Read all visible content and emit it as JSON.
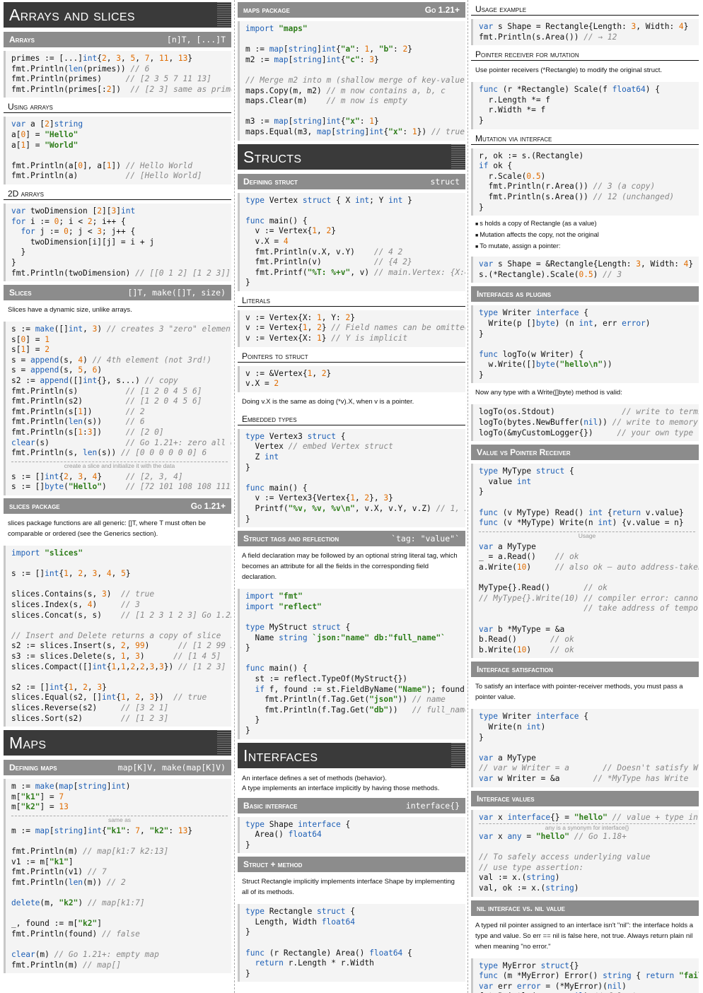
{
  "col1": {
    "arrays_title": "Arrays and slices",
    "arrays_h": "Arrays",
    "arrays_sig": "[n]T, [...]T",
    "using_arrays_h": "Using arrays",
    "twod_h": "2D arrays",
    "slices_h": "Slices",
    "slices_sig": "[]T, make([]T, size)",
    "slices_prose": "Slices have a dynamic size, unlike arrays.",
    "slices_divider": "create a slice and initialize it with the data",
    "slices_pkg_h": "slices package",
    "slices_pkg_ver": "Go 1.21+",
    "slices_pkg_prose": "slices package functions are all generic: []T, where T must often be comparable or ordered (see the Generics section).",
    "maps_title": "Maps",
    "defmaps_h": "Defining maps",
    "defmaps_sig": "map[K]V, make(map[K]V)",
    "maps_divider": "same as"
  },
  "col2": {
    "maps_pkg_h": "maps package",
    "maps_pkg_ver": "Go 1.21+",
    "structs_title": "Structs",
    "defstruct_h": "Defining struct",
    "defstruct_sig": "struct",
    "literals_h": "Literals",
    "pointers_h": "Pointers to struct",
    "pointers_prose": "Doing v.X is the same as doing (*v).X, when v is a pointer.",
    "embedded_h": "Embedded types",
    "tags_h": "Struct tags and reflection",
    "tags_sig": "`tag: \"value\"`",
    "tags_prose": "A field declaration may be followed by an optional string literal tag, which becomes an attribute for all the fields in the corresponding field declaration.",
    "interfaces_title": "Interfaces",
    "interfaces_prose1": "An interface defines a set of methods (behavior).",
    "interfaces_prose2": "A type implements an interface implicitly by having those methods.",
    "basic_h": "Basic interface",
    "basic_sig": "interface{}",
    "structmethod_h": "Struct + method",
    "structmethod_prose": "Struct Rectangle implicitly implements interface Shape by implementing all of its methods."
  },
  "col3": {
    "usage_h": "Usage example",
    "ptrrecv_h": "Pointer receiver for mutation",
    "ptrrecv_prose": "Use pointer receivers (*Rectangle) to modify the original struct.",
    "mutiface_h": "Mutation via interface",
    "bullets": [
      "s holds a copy of Rectangle (as a value)",
      "Mutation affects the copy, not the original",
      "To mutate, assign a pointer:"
    ],
    "plugins_h": "Interfaces as plugins",
    "plugins_prose": "Now any type with a Write([]byte) method is valid:",
    "vp_h": "Value vs Pointer Receiver",
    "vp_divider": "Usage",
    "satisfaction_h": "Interface satisfaction",
    "satisfaction_prose": "To satisfy an interface with pointer-receiver methods, you must pass a pointer value.",
    "values_h": "Interface values",
    "values_divider": "any is a synonym for interface{}",
    "nil_h": "nil interface vs. nil value",
    "nil_prose": "A typed nil pointer assigned to an interface isn't \"nil\": the interface holds a type and value. So err == nil is false here, not true. Always return plain nil when meaning \"no error.\""
  }
}
